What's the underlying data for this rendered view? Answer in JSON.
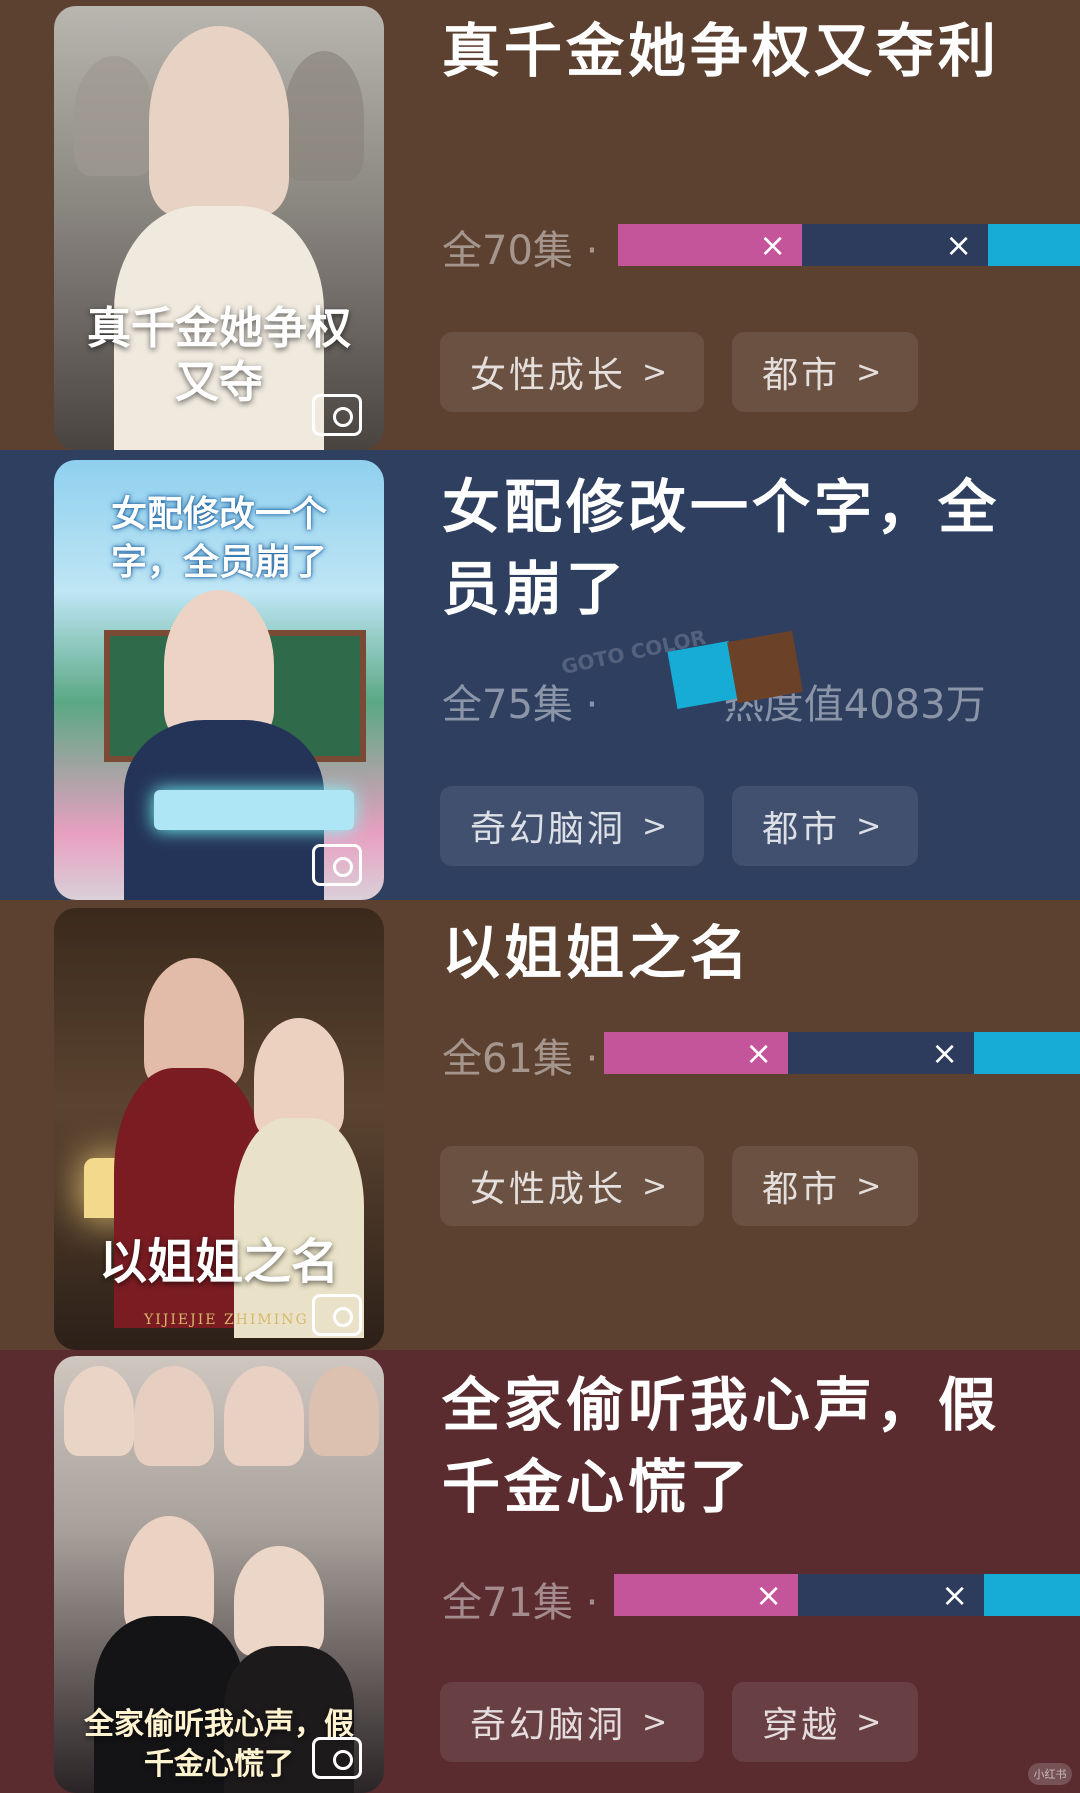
{
  "palette": {
    "pink": "#c5559a",
    "navy": "#2d3b5c",
    "cyan": "#16acd5",
    "brown": "#6b4128"
  },
  "items": [
    {
      "title": "真千金她争权又夺利",
      "episodes": "全70集",
      "sep": "·",
      "poster_title": "真千金她争权又夺",
      "tags": [
        "女性成长",
        "都市"
      ],
      "background": "#5c4030"
    },
    {
      "title": "女配修改一个字，全员崩了",
      "episodes": "全75集",
      "sep": "·",
      "heat": "热度值4083万",
      "poster_title": "女配修改一个字，全员崩了",
      "tags": [
        "奇幻脑洞",
        "都市"
      ],
      "background": "#2e3f60"
    },
    {
      "title": "以姐姐之名",
      "episodes": "全61集",
      "sep": "·",
      "poster_title": "以姐姐之名",
      "poster_subtitle": "YIJIEJIE ZHIMING",
      "tags": [
        "女性成长",
        "都市"
      ],
      "background": "#5c4030"
    },
    {
      "title": "全家偷听我心声，假千金心慌了",
      "episodes": "全71集",
      "sep": "·",
      "poster_title": "全家偷听我心声，假千金心慌了",
      "tags": [
        "奇幻脑洞",
        "穿越"
      ],
      "background": "#5a2c30"
    }
  ],
  "overlay_text": {
    "watermark": "GOTO COLOR",
    "x_mark": "×",
    "chevron": ">",
    "corner_badge": "小红书"
  }
}
